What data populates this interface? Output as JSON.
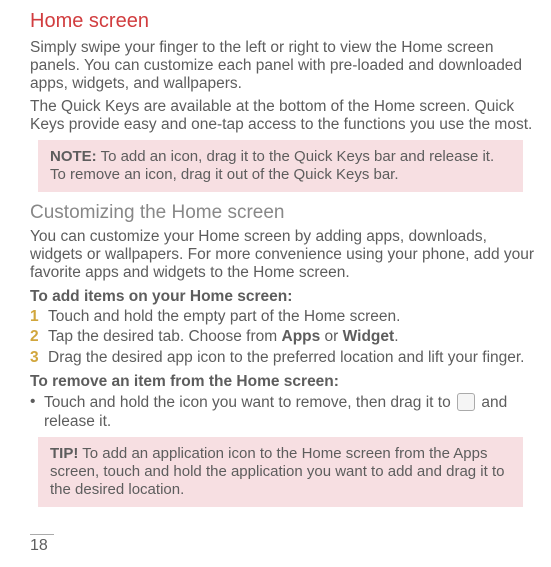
{
  "page_number": "18",
  "section1": {
    "title": "Home screen",
    "p1": "Simply swipe your finger to the left or right to view the Home screen panels. You can customize each panel with pre-loaded and downloaded apps, widgets, and wallpapers.",
    "p2": "The Quick Keys are available at the bottom of the Home screen. Quick Keys provide easy and one-tap access to the functions you use the most."
  },
  "note": {
    "label": "NOTE:",
    "text": " To add an icon, drag it to the Quick Keys bar and release it. To remove an icon, drag it out of the Quick Keys bar."
  },
  "section2": {
    "title": "Customizing the Home screen",
    "p1": "You can customize your Home screen by adding apps, downloads, widgets or wallpapers. For more convenience using your phone, add your favorite apps and widgets to the Home screen.",
    "add_head": "To add items on your Home screen:",
    "steps": [
      {
        "n": "1",
        "text": "Touch and hold the empty part of the Home screen."
      },
      {
        "n": "2",
        "prefix": "Tap the desired tab. Choose from ",
        "bold1": "Apps",
        "mid": " or ",
        "bold2": "Widget",
        "suffix": "."
      },
      {
        "n": "3",
        "text": "Drag the desired app icon to the preferred location and lift your finger."
      }
    ],
    "remove_head": "To remove an item from the Home screen:",
    "remove_bullet": "•",
    "remove_prefix": "Touch and hold the icon you want to remove, then drag it to ",
    "remove_suffix": " and release it."
  },
  "tip": {
    "label": "TIP!",
    "text": " To add an application icon to the Home screen from the Apps screen, touch and hold the application you want to add and drag it to the desired location."
  }
}
